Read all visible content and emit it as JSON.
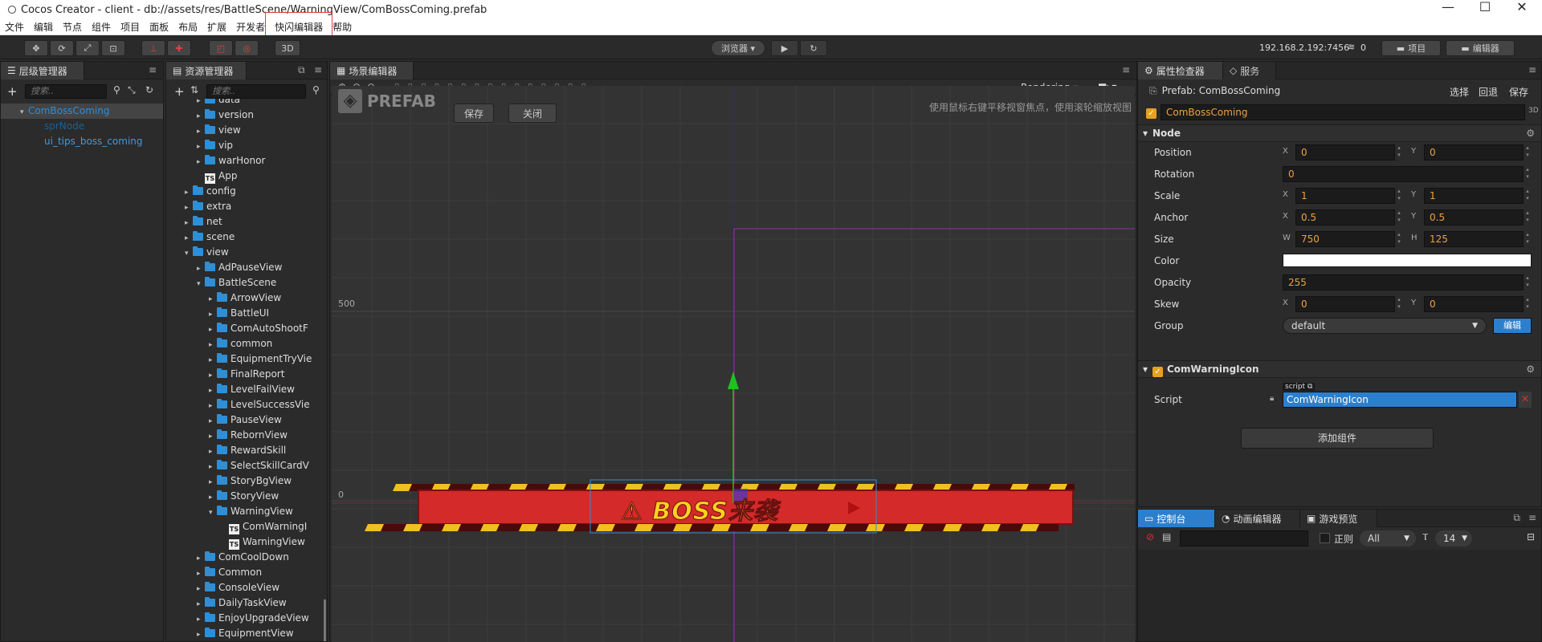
{
  "window": {
    "title": "Cocos Creator - client - db://assets/res/BattleScene/WarningView/ComBossComing.prefab",
    "minimize": "—",
    "maximize": "☐",
    "close": "✕"
  },
  "menu": [
    "文件",
    "编辑",
    "节点",
    "组件",
    "项目",
    "面板",
    "布局",
    "扩展",
    "开发者",
    "快闪编辑器",
    "帮助"
  ],
  "toolbar": {
    "mode_3d": "3D",
    "browser": "浏览器 ▾",
    "ip": "192.168.2.192:7456",
    "connections": "0",
    "project_btn": "项目",
    "editor_btn": "编辑器"
  },
  "hierarchy": {
    "tab": "层级管理器",
    "search_placeholder": "搜索..",
    "nodes": [
      {
        "label": "ComBossComing",
        "level": 0,
        "color": "#2e8fd6",
        "selected": true
      },
      {
        "label": "sprNode",
        "level": 1,
        "color": "#1f5f8f"
      },
      {
        "label": "ui_tips_boss_coming",
        "level": 1,
        "color": "#3d9be0"
      }
    ]
  },
  "assets": {
    "tab": "资源管理器",
    "search_placeholder": "搜索..",
    "items": [
      {
        "label": "data",
        "level": 2,
        "type": "folder",
        "expand": "▸"
      },
      {
        "label": "version",
        "level": 2,
        "type": "folder",
        "expand": "▸"
      },
      {
        "label": "view",
        "level": 2,
        "type": "folder",
        "expand": "▸"
      },
      {
        "label": "vip",
        "level": 2,
        "type": "folder",
        "expand": "▸"
      },
      {
        "label": "warHonor",
        "level": 2,
        "type": "folder",
        "expand": "▸"
      },
      {
        "label": "App",
        "level": 2,
        "type": "ts",
        "expand": ""
      },
      {
        "label": "config",
        "level": 1,
        "type": "folder",
        "expand": "▸"
      },
      {
        "label": "extra",
        "level": 1,
        "type": "folder",
        "expand": "▸"
      },
      {
        "label": "net",
        "level": 1,
        "type": "folder",
        "expand": "▸"
      },
      {
        "label": "scene",
        "level": 1,
        "type": "folder",
        "expand": "▸"
      },
      {
        "label": "view",
        "level": 1,
        "type": "folder",
        "expand": "▾"
      },
      {
        "label": "AdPauseView",
        "level": 2,
        "type": "folder",
        "expand": "▸"
      },
      {
        "label": "BattleScene",
        "level": 2,
        "type": "folder",
        "expand": "▾"
      },
      {
        "label": "ArrowView",
        "level": 3,
        "type": "folder",
        "expand": "▸"
      },
      {
        "label": "BattleUI",
        "level": 3,
        "type": "folder",
        "expand": "▸"
      },
      {
        "label": "ComAutoShootF",
        "level": 3,
        "type": "folder",
        "expand": "▸"
      },
      {
        "label": "common",
        "level": 3,
        "type": "folder",
        "expand": "▸"
      },
      {
        "label": "EquipmentTryVie",
        "level": 3,
        "type": "folder",
        "expand": "▸"
      },
      {
        "label": "FinalReport",
        "level": 3,
        "type": "folder",
        "expand": "▸"
      },
      {
        "label": "LevelFailView",
        "level": 3,
        "type": "folder",
        "expand": "▸"
      },
      {
        "label": "LevelSuccessVie",
        "level": 3,
        "type": "folder",
        "expand": "▸"
      },
      {
        "label": "PauseView",
        "level": 3,
        "type": "folder",
        "expand": "▸"
      },
      {
        "label": "RebornView",
        "level": 3,
        "type": "folder",
        "expand": "▸"
      },
      {
        "label": "RewardSkill",
        "level": 3,
        "type": "folder",
        "expand": "▸"
      },
      {
        "label": "SelectSkillCardV",
        "level": 3,
        "type": "folder",
        "expand": "▸"
      },
      {
        "label": "StoryBgView",
        "level": 3,
        "type": "folder",
        "expand": "▸"
      },
      {
        "label": "StoryView",
        "level": 3,
        "type": "folder",
        "expand": "▸"
      },
      {
        "label": "WarningView",
        "level": 3,
        "type": "folder",
        "expand": "▾"
      },
      {
        "label": "ComWarningI",
        "level": 4,
        "type": "ts",
        "expand": ""
      },
      {
        "label": "WarningView",
        "level": 4,
        "type": "ts",
        "expand": ""
      },
      {
        "label": "ComCoolDown",
        "level": 2,
        "type": "folder",
        "expand": "▸"
      },
      {
        "label": "Common",
        "level": 2,
        "type": "folder",
        "expand": "▸"
      },
      {
        "label": "ConsoleView",
        "level": 2,
        "type": "folder",
        "expand": "▸"
      },
      {
        "label": "DailyTaskView",
        "level": 2,
        "type": "folder",
        "expand": "▸"
      },
      {
        "label": "EnjoyUpgradeView",
        "level": 2,
        "type": "folder",
        "expand": "▸"
      },
      {
        "label": "EquipmentView",
        "level": 2,
        "type": "folder",
        "expand": "▸"
      }
    ]
  },
  "scene": {
    "tab": "场景编辑器",
    "rendering": "Rendering",
    "prefab_label": "PREFAB",
    "save": "保存",
    "close": "关闭",
    "hint": "使用鼠标右键平移视窗焦点，使用滚轮缩放视图",
    "axis_500": "500",
    "axis_0": "0",
    "banner_text": "BOSS来袭",
    "warn_glyph": "⚠"
  },
  "inspector": {
    "tab": "属性检查器",
    "tab2": "服务",
    "prefab": "Prefab: ComBossComing",
    "select": "选择",
    "revert": "回退",
    "save": "保存",
    "node_name": "ComBossComing",
    "mode_3d": "3D",
    "node_section": "Node",
    "props": {
      "position": {
        "label": "Position",
        "x": "0",
        "y": "0"
      },
      "rotation": {
        "label": "Rotation",
        "v": "0"
      },
      "scale": {
        "label": "Scale",
        "x": "1",
        "y": "1"
      },
      "anchor": {
        "label": "Anchor",
        "x": "0.5",
        "y": "0.5"
      },
      "size": {
        "label": "Size",
        "w": "750",
        "h": "125"
      },
      "color": {
        "label": "Color"
      },
      "opacity": {
        "label": "Opacity",
        "v": "255"
      },
      "skew": {
        "label": "Skew",
        "x": "0",
        "y": "0"
      },
      "group": {
        "label": "Group",
        "v": "default",
        "edit": "编辑"
      }
    },
    "component": "ComWarningIcon",
    "script_label": "Script",
    "script_tag": "script",
    "script_value": "ComWarningIcon",
    "add_component": "添加组件",
    "xlabel": "X",
    "ylabel": "Y",
    "wlabel": "W",
    "hlabel": "H"
  },
  "console": {
    "tabs": [
      "控制台",
      "动画编辑器",
      "游戏预览"
    ],
    "regex": "正则",
    "level": "All",
    "font_size": "14"
  }
}
